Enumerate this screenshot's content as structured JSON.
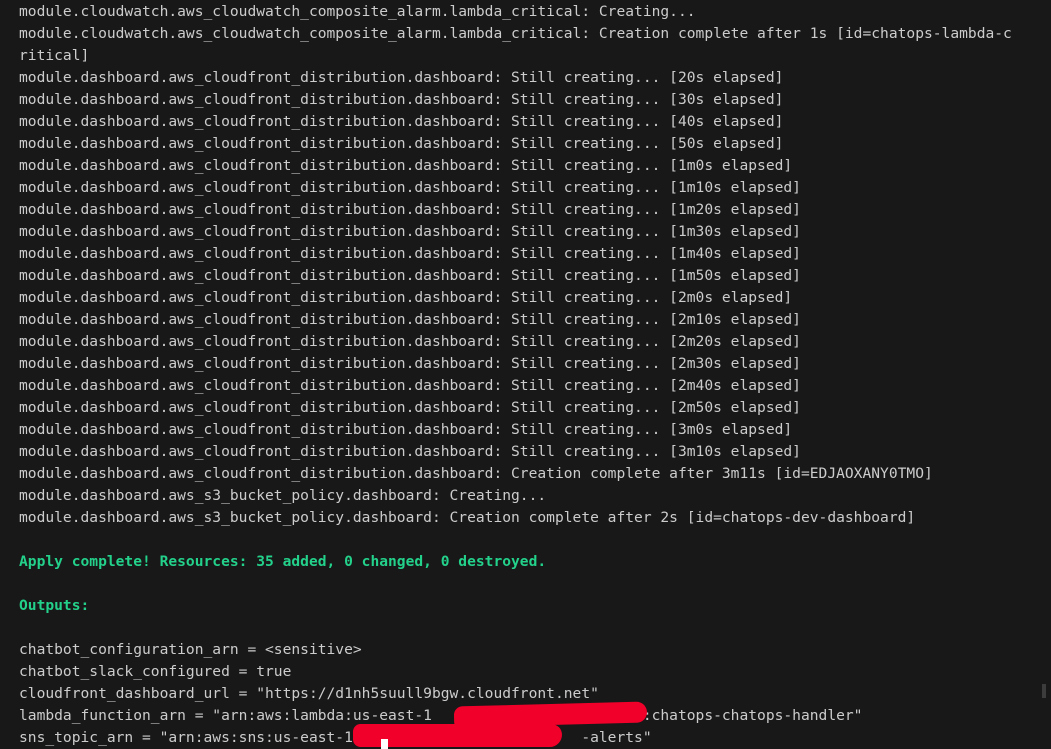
{
  "terminal": {
    "log_lines": [
      "module.cloudwatch.aws_cloudwatch_composite_alarm.lambda_critical: Creating...",
      "module.cloudwatch.aws_cloudwatch_composite_alarm.lambda_critical: Creation complete after 1s [id=chatops-lambda-c",
      "ritical]",
      "module.dashboard.aws_cloudfront_distribution.dashboard: Still creating... [20s elapsed]",
      "module.dashboard.aws_cloudfront_distribution.dashboard: Still creating... [30s elapsed]",
      "module.dashboard.aws_cloudfront_distribution.dashboard: Still creating... [40s elapsed]",
      "module.dashboard.aws_cloudfront_distribution.dashboard: Still creating... [50s elapsed]",
      "module.dashboard.aws_cloudfront_distribution.dashboard: Still creating... [1m0s elapsed]",
      "module.dashboard.aws_cloudfront_distribution.dashboard: Still creating... [1m10s elapsed]",
      "module.dashboard.aws_cloudfront_distribution.dashboard: Still creating... [1m20s elapsed]",
      "module.dashboard.aws_cloudfront_distribution.dashboard: Still creating... [1m30s elapsed]",
      "module.dashboard.aws_cloudfront_distribution.dashboard: Still creating... [1m40s elapsed]",
      "module.dashboard.aws_cloudfront_distribution.dashboard: Still creating... [1m50s elapsed]",
      "module.dashboard.aws_cloudfront_distribution.dashboard: Still creating... [2m0s elapsed]",
      "module.dashboard.aws_cloudfront_distribution.dashboard: Still creating... [2m10s elapsed]",
      "module.dashboard.aws_cloudfront_distribution.dashboard: Still creating... [2m20s elapsed]",
      "module.dashboard.aws_cloudfront_distribution.dashboard: Still creating... [2m30s elapsed]",
      "module.dashboard.aws_cloudfront_distribution.dashboard: Still creating... [2m40s elapsed]",
      "module.dashboard.aws_cloudfront_distribution.dashboard: Still creating... [2m50s elapsed]",
      "module.dashboard.aws_cloudfront_distribution.dashboard: Still creating... [3m0s elapsed]",
      "module.dashboard.aws_cloudfront_distribution.dashboard: Still creating... [3m10s elapsed]",
      "module.dashboard.aws_cloudfront_distribution.dashboard: Creation complete after 3m11s [id=EDJAOXANY0TMO]",
      "module.dashboard.aws_s3_bucket_policy.dashboard: Creating...",
      "module.dashboard.aws_s3_bucket_policy.dashboard: Creation complete after 2s [id=chatops-dev-dashboard]"
    ],
    "apply_summary": "Apply complete! Resources: 35 added, 0 changed, 0 destroyed.",
    "outputs_heading": "Outputs:",
    "outputs": [
      "chatbot_configuration_arn = <sensitive>",
      "chatbot_slack_configured = true",
      "cloudfront_dashboard_url = \"https://d1nh5suull9bgw.cloudfront.net\"",
      "lambda_function_arn = \"arn:aws:lambda:us-east-1                        :chatops-chatops-handler\"",
      "sns_topic_arn = \"arn:aws:sns:us-east-1                          -alerts\""
    ],
    "colors": {
      "background": "#181818",
      "text": "#cccccc",
      "success_green": "#23d18b",
      "redaction_red": "#f1002a"
    }
  }
}
